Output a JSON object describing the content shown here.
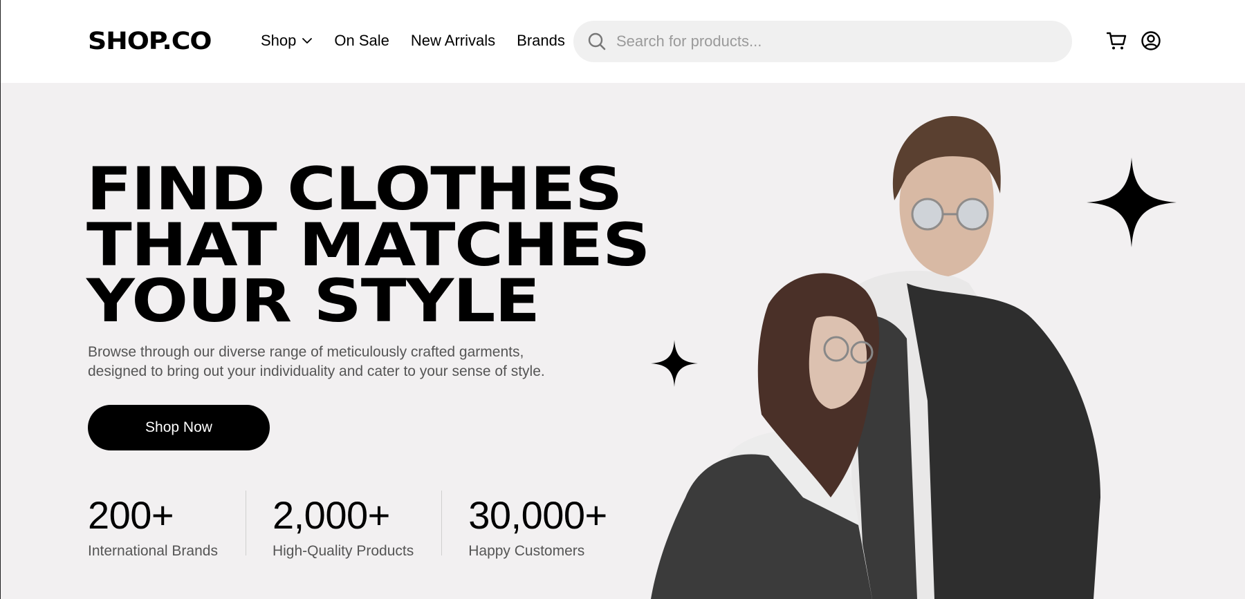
{
  "header": {
    "logo": "SHOP.CO",
    "nav": [
      {
        "label": "Shop",
        "has_dropdown": true
      },
      {
        "label": "On Sale"
      },
      {
        "label": "New Arrivals"
      },
      {
        "label": "Brands"
      }
    ],
    "search": {
      "placeholder": "Search for products...",
      "icon": "search-icon"
    },
    "icons": [
      "cart-icon",
      "user-account-icon"
    ]
  },
  "hero": {
    "headline_lines": [
      "FIND CLOTHES",
      "THAT MATCHES",
      "YOUR STYLE"
    ],
    "description": "Browse through our diverse range of meticulously crafted garments, designed to bring out your individuality and cater to your sense of style.",
    "cta_label": "Shop Now",
    "stats": [
      {
        "value": "200+",
        "label": "International Brands"
      },
      {
        "value": "2,000+",
        "label": "High-Quality Products"
      },
      {
        "value": "30,000+",
        "label": "Happy Customers"
      }
    ],
    "background": "#f2f0f1"
  },
  "colors": {
    "primary": "#000000",
    "muted_text": "#555555",
    "search_bg": "#f0f0f0"
  }
}
